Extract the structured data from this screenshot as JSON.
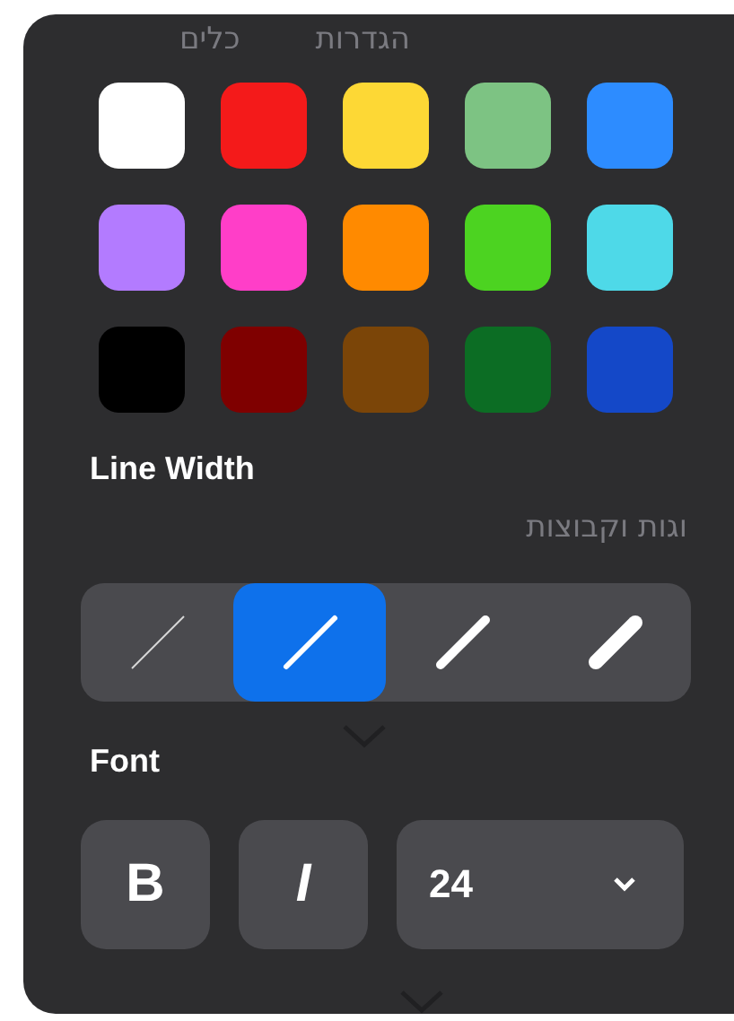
{
  "background_page": {
    "tabs": [
      "הגדרות",
      "כלים"
    ],
    "section_title": "וגות וקבוצות"
  },
  "palette": {
    "colors": [
      {
        "color": "#ffffff"
      },
      {
        "color": "#f41a1a"
      },
      {
        "color": "#fdd835"
      },
      {
        "color": "#7dc383"
      },
      {
        "color": "#2d8cff"
      },
      {
        "color": "#b37bff"
      },
      {
        "color": "#ff3ec8"
      },
      {
        "color": "#ff8a00"
      },
      {
        "color": "#4cd321"
      },
      {
        "color": "#4ed9e8"
      },
      {
        "color": "#000000"
      },
      {
        "color": "#7f0000"
      },
      {
        "color": "#7b4508"
      },
      {
        "color": "#0c6d24"
      },
      {
        "color": "#1448c8"
      }
    ]
  },
  "line_width": {
    "label": "Line Width",
    "options": [
      {
        "selected": false
      },
      {
        "selected": true
      },
      {
        "selected": false
      },
      {
        "selected": false
      }
    ]
  },
  "font": {
    "label": "Font",
    "bold": {
      "text": "B",
      "selected": false
    },
    "italic": {
      "text": "I",
      "selected": false
    },
    "size": "24"
  }
}
